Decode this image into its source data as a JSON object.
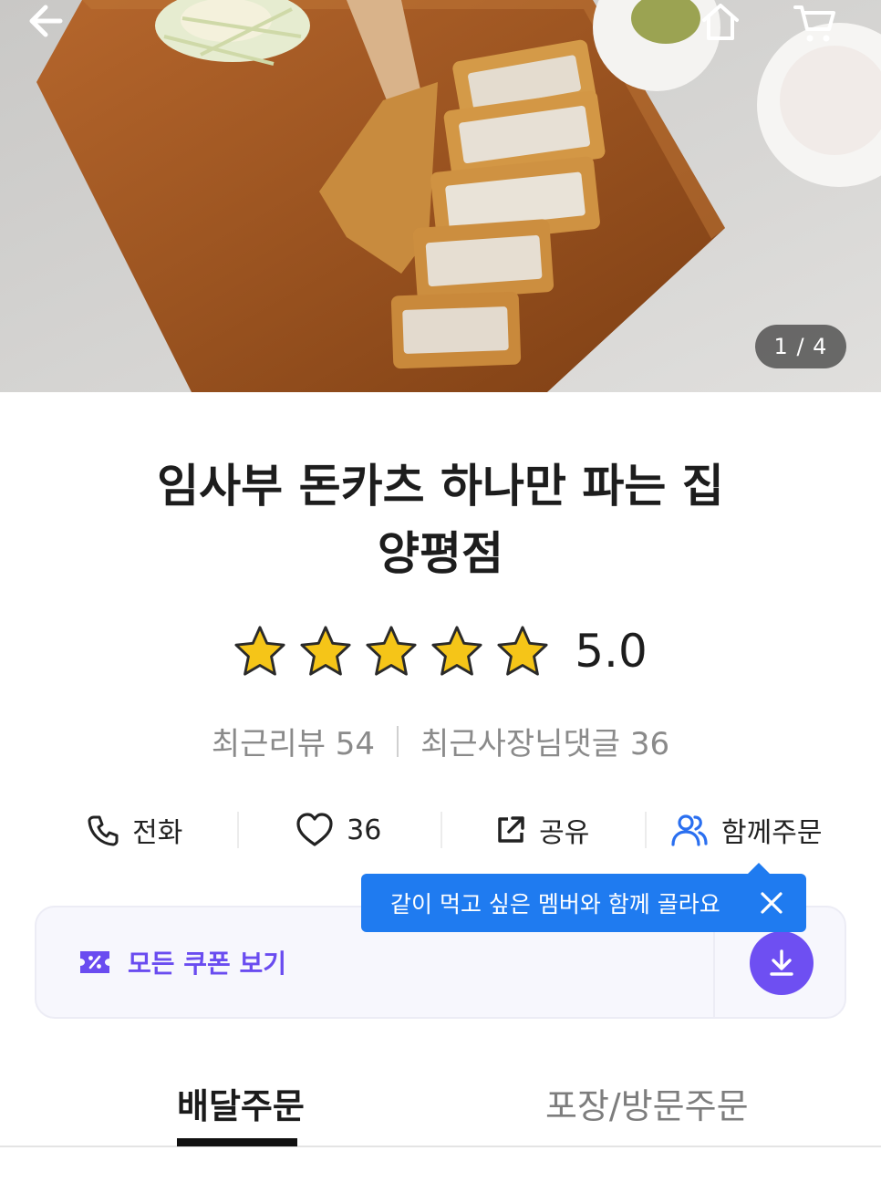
{
  "hero": {
    "page_indicator": "1 / 4",
    "icons": [
      "back-arrow-icon",
      "home-icon",
      "cart-icon"
    ]
  },
  "store": {
    "name_line1": "임사부 돈카츠 하나만 파는 집",
    "name_line2": "양평점",
    "rating": 5.0,
    "rating_label": "5.0",
    "stars_filled": 5,
    "stars_total": 5,
    "recent_reviews": "최근리뷰 54",
    "recent_owner_replies": "최근사장님댓글 36"
  },
  "actions": [
    {
      "icon": "phone-icon",
      "label": "전화"
    },
    {
      "icon": "heart-icon",
      "label": "36"
    },
    {
      "icon": "share-icon",
      "label": "공유"
    },
    {
      "icon": "group-icon",
      "label": "함께주문"
    }
  ],
  "tooltip": {
    "text": "같이 먹고 싶은 멤버와 함께 골라요",
    "color": "#1f7bf0"
  },
  "coupon": {
    "label": "모든 쿠폰 보기",
    "accent": "#6e4ff2"
  },
  "tabs": [
    {
      "label": "배달주문",
      "selected": true
    },
    {
      "label": "포장/방문주문",
      "selected": false
    }
  ],
  "colors": {
    "star": "#f5c518",
    "text": "#1d1d1d",
    "muted": "#8a8a8a"
  }
}
